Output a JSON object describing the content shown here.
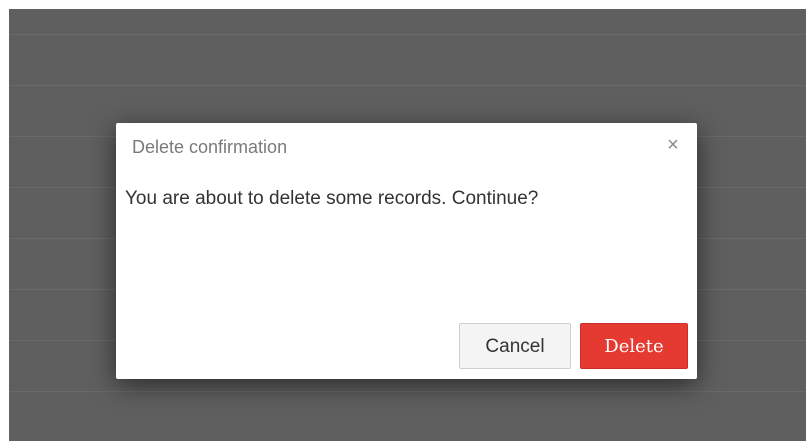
{
  "dialog": {
    "title": "Delete confirmation",
    "close_symbol": "×",
    "close_icon": "close-icon",
    "message": "You are about to delete some records. Continue?",
    "cancel_label": "Cancel",
    "delete_label": "Delete"
  },
  "colors": {
    "overlay": "#5f5f5f",
    "danger": "#e53a31",
    "cancel_bg": "#f4f4f4"
  }
}
